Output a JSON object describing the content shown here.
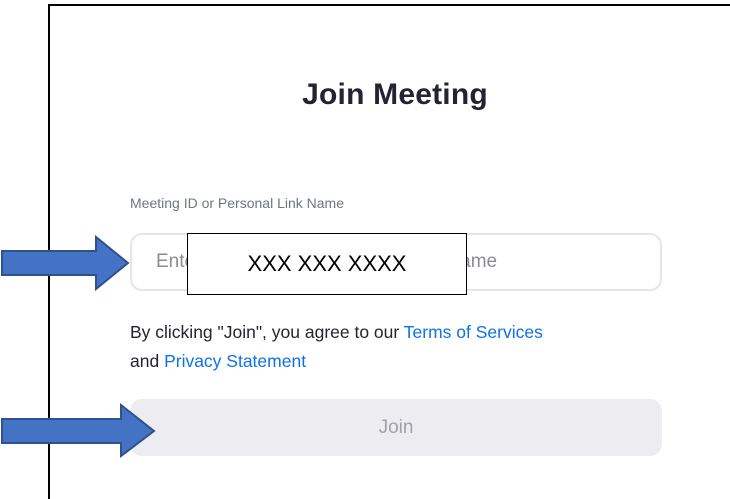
{
  "title": "Join Meeting",
  "meeting_field": {
    "label": "Meeting ID or Personal Link Name",
    "placeholder": "Enter Meeting ID or Personal Link Name",
    "redaction_text": "XXX XXX XXXX"
  },
  "agreement": {
    "prefix": "By clicking \"Join\", you agree to our ",
    "terms_link": "Terms of Services",
    "middle": " and ",
    "privacy_link": "Privacy Statement"
  },
  "join_button": {
    "label": "Join"
  },
  "colors": {
    "link": "#0e71eb",
    "arrow_fill": "#4472c4",
    "arrow_stroke": "#2f528f",
    "button_bg": "#ededf1"
  }
}
